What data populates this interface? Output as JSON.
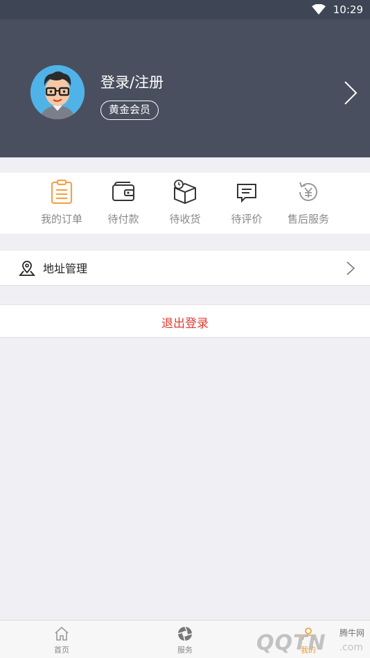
{
  "status_bar": {
    "time": "10:29"
  },
  "header": {
    "login_label": "登录/注册",
    "member_badge": "黄金会员"
  },
  "orders": [
    {
      "label": "我的订单",
      "icon": "clipboard-icon"
    },
    {
      "label": "待付款",
      "icon": "wallet-icon"
    },
    {
      "label": "待收货",
      "icon": "box-clock-icon"
    },
    {
      "label": "待评价",
      "icon": "comment-icon"
    },
    {
      "label": "售后服务",
      "icon": "refund-yen-icon"
    }
  ],
  "address_row": {
    "label": "地址管理",
    "icon": "map-pin-icon"
  },
  "logout": {
    "label": "退出登录",
    "color": "#e03a2f"
  },
  "tabbar": [
    {
      "label": "首页",
      "icon": "home-icon"
    },
    {
      "label": "服务",
      "icon": "aperture-icon"
    },
    {
      "label": "我的",
      "icon": "user-icon"
    }
  ],
  "watermark": {
    "site": "腾牛网",
    "logo": "QQTN",
    "domain": ".com"
  },
  "colors": {
    "header_bg": "#4a4f5f",
    "accent": "#f39a2b",
    "logout": "#e03a2f"
  }
}
